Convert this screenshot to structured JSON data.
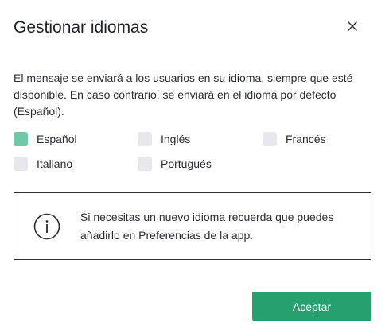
{
  "dialog": {
    "title": "Gestionar idiomas",
    "close_icon": "close-icon",
    "description": "El mensaje se enviará a los usuarios en su idioma, siempre que esté disponible. En caso contrario, se enviará en el idioma por defecto (Español)."
  },
  "languages": [
    {
      "label": "Español",
      "checked": true
    },
    {
      "label": "Inglés",
      "checked": false
    },
    {
      "label": "Francés",
      "checked": false
    },
    {
      "label": "Italiano",
      "checked": false
    },
    {
      "label": "Portugués",
      "checked": false
    }
  ],
  "info": {
    "icon": "info-icon",
    "text": "Si necesitas un nuevo idioma recuerda que puedes añadirlo en Preferencias de la app."
  },
  "actions": {
    "accept_label": "Aceptar"
  },
  "colors": {
    "accent": "#27a06f",
    "checkbox_checked": "#72c7a6",
    "checkbox_unchecked": "#e6e8ee"
  }
}
